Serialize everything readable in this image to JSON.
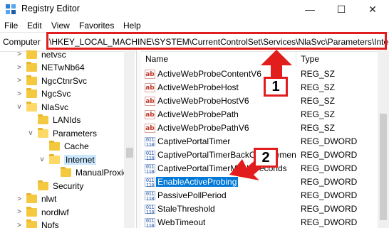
{
  "window": {
    "title": "Registry Editor",
    "minimize_symbol": "—",
    "maximize_symbol": "☐",
    "close_symbol": "✕"
  },
  "menu": [
    "File",
    "Edit",
    "View",
    "Favorites",
    "Help"
  ],
  "address": {
    "label": "Computer",
    "path": "\\HKEY_LOCAL_MACHINE\\SYSTEM\\CurrentControlSet\\Services\\NlaSvc\\Parameters\\Internet"
  },
  "tree": [
    {
      "label": "netvsc",
      "chevron": ">",
      "depth": 0
    },
    {
      "label": "NETwNb64",
      "chevron": ">",
      "depth": 0
    },
    {
      "label": "NgcCtnrSvc",
      "chevron": ">",
      "depth": 0
    },
    {
      "label": "NgcSvc",
      "chevron": ">",
      "depth": 0
    },
    {
      "label": "NlaSvc",
      "chevron": "v",
      "depth": 0
    },
    {
      "label": "LANIds",
      "chevron": "",
      "depth": 1
    },
    {
      "label": "Parameters",
      "chevron": "v",
      "depth": 1
    },
    {
      "label": "Cache",
      "chevron": "",
      "depth": 2
    },
    {
      "label": "Internet",
      "chevron": "v",
      "depth": 2,
      "selected": true
    },
    {
      "label": "ManualProxie",
      "chevron": "",
      "depth": 3
    },
    {
      "label": "Security",
      "chevron": "",
      "depth": 1
    },
    {
      "label": "nlwt",
      "chevron": ">",
      "depth": 0
    },
    {
      "label": "nordlwf",
      "chevron": ">",
      "depth": 0
    },
    {
      "label": "Npfs",
      "chevron": ">",
      "depth": 0
    }
  ],
  "list": {
    "headers": {
      "name": "Name",
      "type": "Type"
    },
    "rows": [
      {
        "icon": "ab",
        "name": "ActiveWebProbeContentV6",
        "type": "REG_SZ"
      },
      {
        "icon": "ab",
        "name": "ActiveWebProbeHost",
        "type": "REG_SZ"
      },
      {
        "icon": "ab",
        "name": "ActiveWebProbeHostV6",
        "type": "REG_SZ"
      },
      {
        "icon": "ab",
        "name": "ActiveWebProbePath",
        "type": "REG_SZ"
      },
      {
        "icon": "ab",
        "name": "ActiveWebProbePathV6",
        "type": "REG_SZ"
      },
      {
        "icon": "dw",
        "name": "CaptivePortalTimer",
        "type": "REG_DWORD"
      },
      {
        "icon": "dw",
        "name": "CaptivePortalTimerBackOffIncrementsInSeconds",
        "type": "REG_DWORD"
      },
      {
        "icon": "dw",
        "name": "CaptivePortalTimerMaxInSeconds",
        "type": "REG_DWORD"
      },
      {
        "icon": "dw",
        "name": "EnableActiveProbing",
        "type": "REG_DWORD",
        "selected": true
      },
      {
        "icon": "dw",
        "name": "PassivePollPeriod",
        "type": "REG_DWORD"
      },
      {
        "icon": "dw",
        "name": "StaleThreshold",
        "type": "REG_DWORD"
      },
      {
        "icon": "dw",
        "name": "WebTimeout",
        "type": "REG_DWORD"
      }
    ]
  },
  "icons": {
    "ab_text": "ab",
    "dw_text": "011\n110"
  },
  "annotations": {
    "step1": "1",
    "step2": "2",
    "color": "#e21d1d"
  }
}
